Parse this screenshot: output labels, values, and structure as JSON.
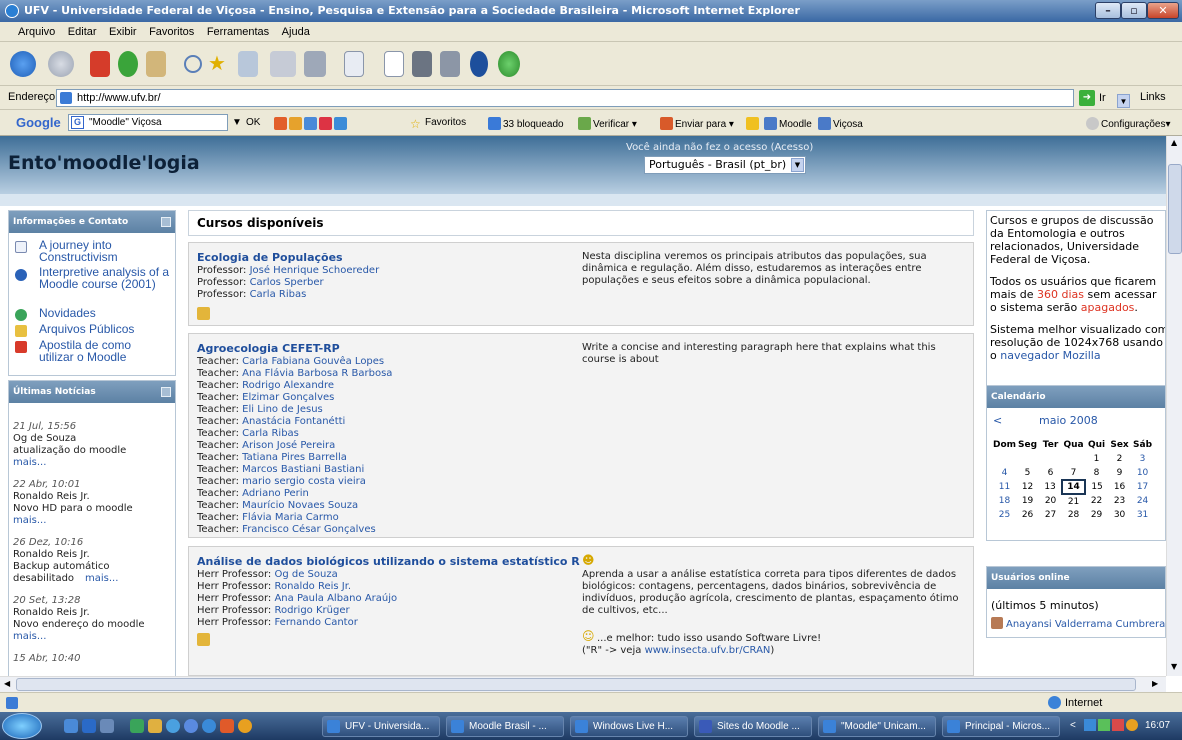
{
  "window": {
    "title": "UFV - Universidade Federal de Viçosa - Ensino, Pesquisa e Extensão para a Sociedade Brasileira - Microsoft Internet Explorer"
  },
  "menu": [
    "Arquivo",
    "Editar",
    "Exibir",
    "Favoritos",
    "Ferramentas",
    "Ajuda"
  ],
  "address": {
    "label": "Endereço",
    "url": "http://www.ufv.br/",
    "go": "Ir",
    "links": "Links"
  },
  "google": {
    "query": "\"Moodle\" Viçosa",
    "ok": "OK",
    "favoritos": "Favoritos",
    "bloqueado": "33 bloqueado",
    "verificar": "Verificar",
    "enviar": "Enviar para",
    "moodle": "Moodle",
    "vicosa": "Viçosa",
    "config": "Configurações"
  },
  "site": {
    "title": "Ento'moodle'logia",
    "login_info": "Você ainda não fez o acesso (Acesso)",
    "language": "Português - Brasil (pt_br)"
  },
  "info_block": {
    "title": "Informações e Contato",
    "items": [
      "A journey into Constructivism",
      "Interpretive analysis of a Moodle course (2001)",
      "Novidades",
      "Arquivos Públicos",
      "Apostila de como utilizar o Moodle"
    ]
  },
  "news_block": {
    "title": "Últimas Notícias",
    "items": [
      {
        "date": "21 Jul, 15:56",
        "author": "Og de Souza",
        "text": "atualização do moodle",
        "more": "mais..."
      },
      {
        "date": "22 Abr, 10:01",
        "author": "Ronaldo Reis Jr.",
        "text": "Novo HD para o moodle",
        "more": "mais..."
      },
      {
        "date": "26 Dez, 10:16",
        "author": "Ronaldo Reis Jr.",
        "text": "Backup automático",
        "text2": "desabilitado",
        "more": "mais..."
      },
      {
        "date": "20 Set, 13:28",
        "author": "Ronaldo Reis Jr.",
        "text": "Novo endereço do moodle",
        "more": "mais..."
      },
      {
        "date": "15 Abr, 10:40"
      }
    ]
  },
  "courses": {
    "heading": "Cursos disponíveis",
    "list": [
      {
        "name": "Ecologia de Populações",
        "teachers": [
          {
            "role": "Professor",
            "name": "José Henrique Schoereder"
          },
          {
            "role": "Professor",
            "name": "Carlos Sperber"
          },
          {
            "role": "Professor",
            "name": "Carla Ribas"
          }
        ],
        "summary": "Nesta disciplina veremos os principais atributos das populações, sua dinâmica e regulação. Além disso, estudaremos as interações entre populações e seus efeitos sobre a dinâmica populacional."
      },
      {
        "name": "Agroecologia CEFET-RP",
        "teachers": [
          {
            "role": "Teacher",
            "name": "Carla Fabiana Gouvêa Lopes"
          },
          {
            "role": "Teacher",
            "name": "Ana Flávia Barbosa R Barbosa"
          },
          {
            "role": "Teacher",
            "name": "Rodrigo Alexandre"
          },
          {
            "role": "Teacher",
            "name": "Elzimar Gonçalves"
          },
          {
            "role": "Teacher",
            "name": "Eli Lino de Jesus"
          },
          {
            "role": "Teacher",
            "name": "Anastácia Fontanétti"
          },
          {
            "role": "Teacher",
            "name": "Carla Ribas"
          },
          {
            "role": "Teacher",
            "name": "Arison José Pereira"
          },
          {
            "role": "Teacher",
            "name": "Tatiana Pires Barrella"
          },
          {
            "role": "Teacher",
            "name": "Marcos Bastiani Bastiani"
          },
          {
            "role": "Teacher",
            "name": "mario sergio costa vieira"
          },
          {
            "role": "Teacher",
            "name": "Adriano Perin"
          },
          {
            "role": "Teacher",
            "name": "Maurício Novaes Souza"
          },
          {
            "role": "Teacher",
            "name": "Flávia Maria Carmo"
          },
          {
            "role": "Teacher",
            "name": "Francisco César Gonçalves"
          }
        ],
        "summary": "Write a concise and interesting paragraph here that explains what this course is about"
      },
      {
        "name": "Análise de dados biológicos utilizando o sistema estatístico R",
        "teachers": [
          {
            "role": "Herr Professor",
            "name": "Og de Souza"
          },
          {
            "role": "Herr Professor",
            "name": "Ronaldo Reis Jr."
          },
          {
            "role": "Herr Professor",
            "name": "Ana Paula Albano Araújo"
          },
          {
            "role": "Herr Professor",
            "name": "Rodrigo Krüger"
          },
          {
            "role": "Herr Professor",
            "name": "Fernando Cantor"
          }
        ],
        "summary": "Aprenda a usar a análise estatística correta para tipos diferentes de dados biológicos: contagens, percentagens, dados binários, sobrevivência de indivíduos, produção agrícola, crescimento de plantas, espaçamento ótimo de cultivos, etc...",
        "summary2": "...e melhor: tudo isso usando Software Livre!",
        "summary3_prefix": "(\"R\" -> veja ",
        "summary3_link": "www.insecta.ufv.br/CRAN",
        "summary3_suffix": ")"
      }
    ]
  },
  "description": {
    "p1": [
      "Cursos e grupos de discussão",
      "da Entomologia e outros",
      "relacionados, Universidade",
      "Federal de Viçosa."
    ],
    "p2a": "Todos os usuários que ficarem",
    "p2b_pre": "mais de ",
    "p2b_red": "360 dias",
    "p2b_post": " sem acessar",
    "p2c_pre": "o sistema serão ",
    "p2c_red": "apagados",
    "p2c_post": ".",
    "p3a": "Sistema melhor visualizado com",
    "p3b": "resolução de 1024x768 usando",
    "p3c_pre": "o ",
    "p3c_link": "navegador Mozilla"
  },
  "calendar": {
    "title": "Calendário",
    "prev": "<",
    "month": "maio 2008",
    "days": [
      "Dom",
      "Seg",
      "Ter",
      "Qua",
      "Qui",
      "Sex",
      "Sáb"
    ],
    "weeks": [
      [
        "",
        "",
        "",
        "",
        "1",
        "2",
        "3"
      ],
      [
        "4",
        "5",
        "6",
        "7",
        "8",
        "9",
        "10"
      ],
      [
        "11",
        "12",
        "13",
        "14",
        "15",
        "16",
        "17"
      ],
      [
        "18",
        "19",
        "20",
        "21",
        "22",
        "23",
        "24"
      ],
      [
        "25",
        "26",
        "27",
        "28",
        "29",
        "30",
        "31"
      ]
    ],
    "today": "14"
  },
  "online": {
    "title": "Usuários online",
    "sub": "(últimos 5 minutos)",
    "user": "Anayansi Valderrama Cumbrera"
  },
  "status": {
    "zone": "Internet"
  },
  "taskbar": {
    "tasks": [
      "UFV - Universida...",
      "Moodle Brasil - ...",
      "Windows Live H...",
      "Sites do Moodle ...",
      "\"Moodle\" Unicam...",
      "Principal - Micros..."
    ],
    "clock": "16:07"
  }
}
